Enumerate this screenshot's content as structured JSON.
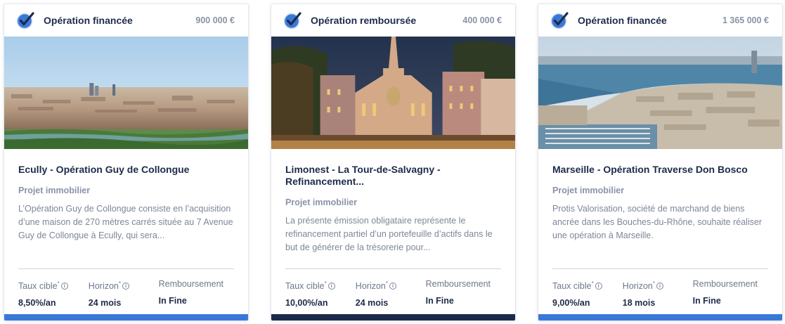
{
  "stat_labels": {
    "rate": "Taux cible",
    "horizon": "Horizon",
    "repayment": "Remboursement",
    "asterisk": "*",
    "info": "i"
  },
  "colors": {
    "financed_bar": "#3a78d8",
    "repaid_bar": "#1b2a4a",
    "check_icon": "#3a78d8"
  },
  "cards": [
    {
      "status": "Opération financée",
      "amount": "900 000 €",
      "title": "Ecully - Opération Guy de Collongue",
      "category": "Projet immobilier",
      "description": "L’Opération Guy de Collongue consiste en l’acquisition d’une maison de 270 mètres carrés située au 7 Avenue Guy de Collongue à Ecully, qui sera...",
      "rate": "8,50%/an",
      "horizon": "24 mois",
      "repayment": "In Fine",
      "bar": "financed"
    },
    {
      "status": "Opération remboursée",
      "amount": "400 000 €",
      "title": "Limonest - La Tour-de-Salvagny - Refinancement...",
      "category": "Projet immobilier",
      "description": "La présente émission obligataire représente le refinancement partiel d’un portefeuille d’actifs dans le but de générer de la trésorerie pour...",
      "rate": "10,00%/an",
      "horizon": "24 mois",
      "repayment": "In Fine",
      "bar": "repaid"
    },
    {
      "status": "Opération financée",
      "amount": "1 365 000 €",
      "title": "Marseille - Opération Traverse Don Bosco",
      "category": "Projet immobilier",
      "description": "Protis Valorisation, société de marchand de biens ancrée dans les Bouches-du-Rhône, souhaite réaliser une opération à Marseille.",
      "rate": "9,00%/an",
      "horizon": "18 mois",
      "repayment": "In Fine",
      "bar": "financed"
    }
  ]
}
